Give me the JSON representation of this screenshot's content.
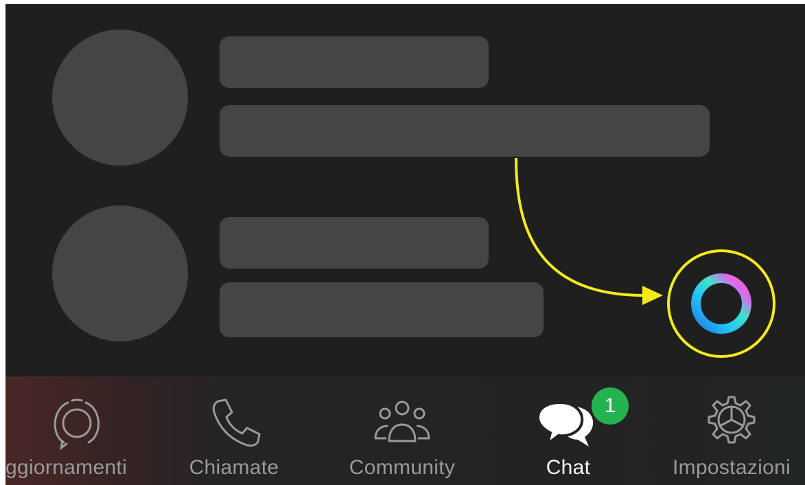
{
  "annotation": {
    "highlight_color": "#f3ea1c",
    "arrow_icon": "curved-arrow-icon"
  },
  "meta_ai": {
    "icon": "meta-ai-ring-icon",
    "gradient_colors": [
      "#1b7cf0",
      "#23c6f3",
      "#3fe3c7",
      "#d86bf0",
      "#ff5fb8"
    ]
  },
  "tab_bar": {
    "tabs": [
      {
        "id": "updates",
        "label": "ggiornamenti",
        "icon": "updates-icon",
        "active": false
      },
      {
        "id": "calls",
        "label": "Chiamate",
        "icon": "phone-icon",
        "active": false
      },
      {
        "id": "community",
        "label": "Community",
        "icon": "community-icon",
        "active": false
      },
      {
        "id": "chat",
        "label": "Chat",
        "icon": "chat-bubbles-icon",
        "active": true,
        "badge": "1"
      },
      {
        "id": "settings",
        "label": "Impostazioni",
        "icon": "gear-icon",
        "active": false
      }
    ],
    "badge_color": "#24b34e"
  }
}
